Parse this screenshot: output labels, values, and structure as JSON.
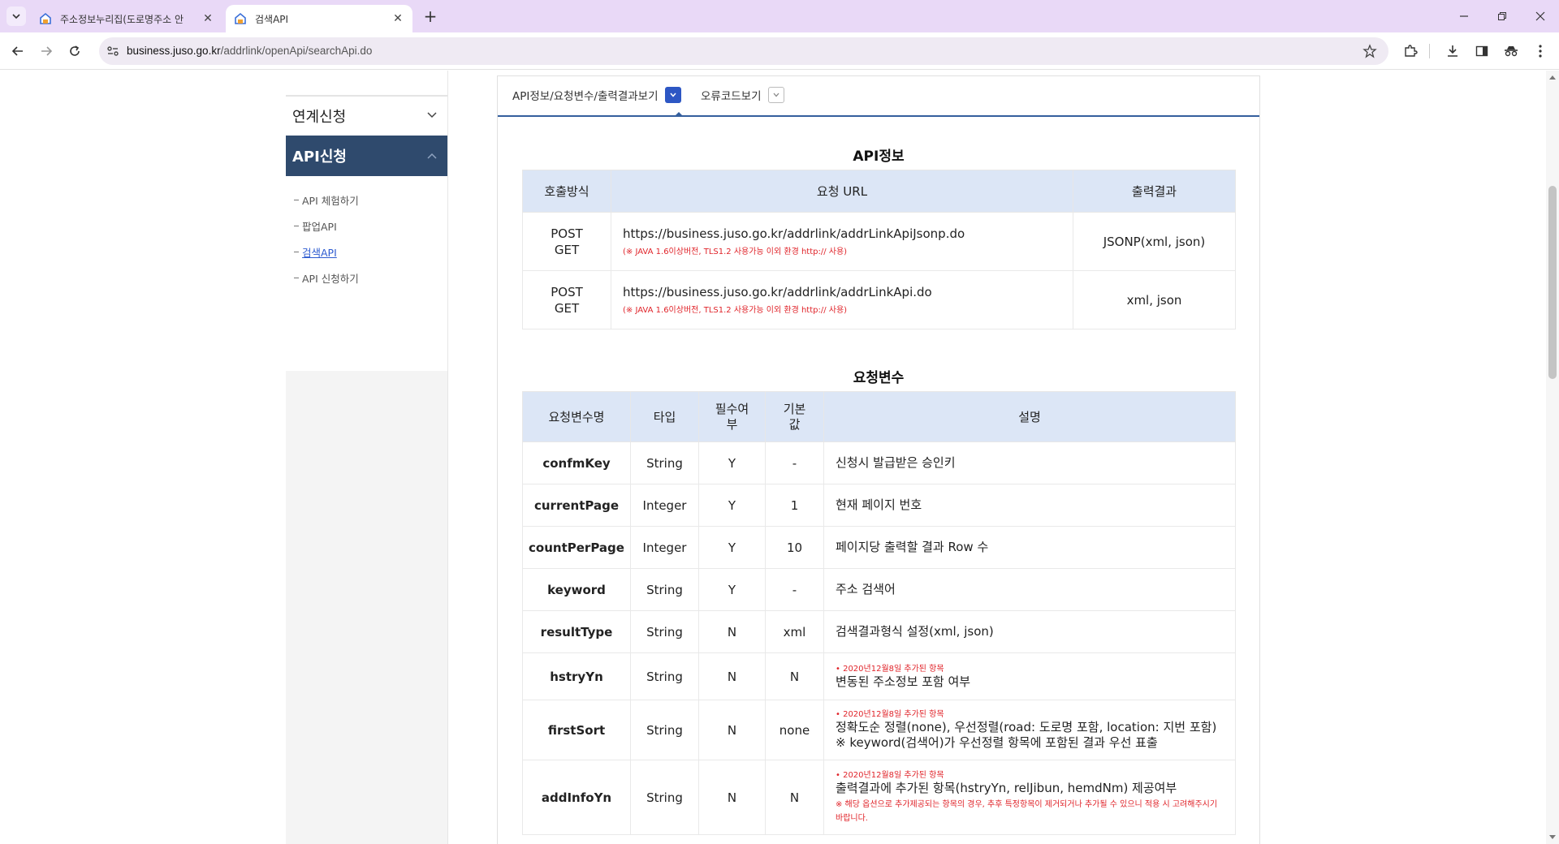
{
  "browser": {
    "tabs": [
      {
        "title": "주소정보누리집(도로명주소 안",
        "active": false
      },
      {
        "title": "검색API",
        "active": true
      }
    ],
    "url": {
      "host": "business.juso.go.kr",
      "path": "/addrlink/openApi/searchApi.do"
    }
  },
  "sidebar": {
    "group1": "연계신청",
    "group2": "API신청",
    "items": [
      {
        "label": "API 체험하기",
        "active": false
      },
      {
        "label": "팝업API",
        "active": false
      },
      {
        "label": "검색API",
        "active": true
      },
      {
        "label": "API 신청하기",
        "active": false
      }
    ]
  },
  "content": {
    "tabs": [
      {
        "label": "API정보/요청변수/출력결과보기",
        "selected": true
      },
      {
        "label": "오류코드보기",
        "selected": false
      }
    ],
    "api_info": {
      "title": "API정보",
      "headers": {
        "method": "호출방식",
        "url": "요청 URL",
        "output": "출력결과"
      },
      "rows": [
        {
          "method_1": "POST",
          "method_2": "GET",
          "url": "https://business.juso.go.kr/addrlink/addrLinkApiJsonp.do",
          "note": "(※ JAVA 1.6이상버전, TLS1.2 사용가능 이외 환경 http:// 사용)",
          "output": "JSONP(xml, json)"
        },
        {
          "method_1": "POST",
          "method_2": "GET",
          "url": "https://business.juso.go.kr/addrlink/addrLinkApi.do",
          "note": "(※ JAVA 1.6이상버전, TLS1.2 사용가능 이외 환경 http:// 사용)",
          "output": "xml, json"
        }
      ]
    },
    "request_params": {
      "title": "요청변수",
      "headers": {
        "name": "요청변수명",
        "type": "타입",
        "required": "필수여부",
        "default": "기본값",
        "desc": "설명"
      },
      "rows": [
        {
          "name": "confmKey",
          "type": "String",
          "required": "Y",
          "default": "-",
          "note": "",
          "desc": "신청시 발급받은 승인키",
          "desc2": "",
          "warn": ""
        },
        {
          "name": "currentPage",
          "type": "Integer",
          "required": "Y",
          "default": "1",
          "note": "",
          "desc": "현재 페이지 번호",
          "desc2": "",
          "warn": ""
        },
        {
          "name": "countPerPage",
          "type": "Integer",
          "required": "Y",
          "default": "10",
          "note": "",
          "desc": "페이지당 출력할 결과 Row 수",
          "desc2": "",
          "warn": ""
        },
        {
          "name": "keyword",
          "type": "String",
          "required": "Y",
          "default": "-",
          "note": "",
          "desc": "주소 검색어",
          "desc2": "",
          "warn": ""
        },
        {
          "name": "resultType",
          "type": "String",
          "required": "N",
          "default": "xml",
          "note": "",
          "desc": "검색결과형식 설정(xml, json)",
          "desc2": "",
          "warn": ""
        },
        {
          "name": "hstryYn",
          "type": "String",
          "required": "N",
          "default": "N",
          "note": "• 2020년12월8일 추가된 항목",
          "desc": "변동된 주소정보 포함 여부",
          "desc2": "",
          "warn": ""
        },
        {
          "name": "firstSort",
          "type": "String",
          "required": "N",
          "default": "none",
          "note": "• 2020년12월8일 추가된 항목",
          "desc": "정확도순 정렬(none), 우선정렬(road: 도로명 포함, location: 지번 포함)",
          "desc2": "※ keyword(검색어)가 우선정렬 항목에 포함된 결과 우선 표출",
          "warn": ""
        },
        {
          "name": "addInfoYn",
          "type": "String",
          "required": "N",
          "default": "N",
          "note": "• 2020년12월8일 추가된 항목",
          "desc": "출력결과에 추가된 항목(hstryYn, relJibun, hemdNm) 제공여부",
          "desc2": "",
          "warn": "※ 해당 옵션으로 추가제공되는 항목의 경우, 추후 특정항목이 제거되거나 추가될 수 있으니 적용 시 고려해주시기 바랍니다."
        }
      ]
    }
  }
}
